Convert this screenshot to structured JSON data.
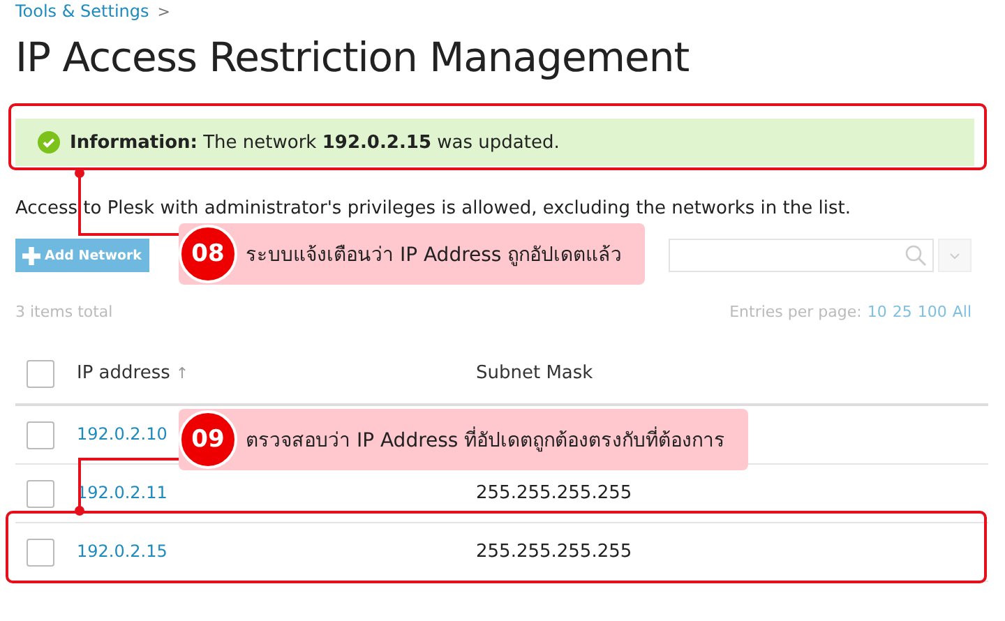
{
  "breadcrumb": {
    "label": "Tools & Settings",
    "separator": ">"
  },
  "title": "IP Access Restriction Management",
  "message": {
    "label": "Information:",
    "text": "The network **192.0.2.15** was updated."
  },
  "description": "Access to Plesk with administrator's privileges is allowed, excluding the networks in the list.",
  "toolbar": {
    "add_button": "Add Network"
  },
  "items_total": "3 items total",
  "entries_per_page": {
    "label": "Entries per page:",
    "options": [
      "10",
      "25",
      "100",
      "All"
    ]
  },
  "table": {
    "all_checked": false,
    "columns": [
      {
        "label": "IP address",
        "sort_indicator": "↑"
      },
      {
        "label": "Subnet Mask"
      }
    ],
    "rows": [
      {
        "ip": "192.0.2.10",
        "checked": false
      },
      {
        "ip": "192.0.2.11",
        "mask": "255.255.255.255",
        "checked": false
      },
      {
        "ip": "192.0.2.15",
        "mask": "255.255.255.255",
        "checked": false
      }
    ]
  },
  "annotations": [
    {
      "number": "08",
      "text": "ระบบแจ้งเตือนว่า IP Address ถูกอัปเดตแล้ว"
    },
    {
      "number": "09",
      "text": "ตรวจสอบว่า IP Address ที่อัปเดตถูกต้องตรงกับที่ต้องการ"
    }
  ]
}
